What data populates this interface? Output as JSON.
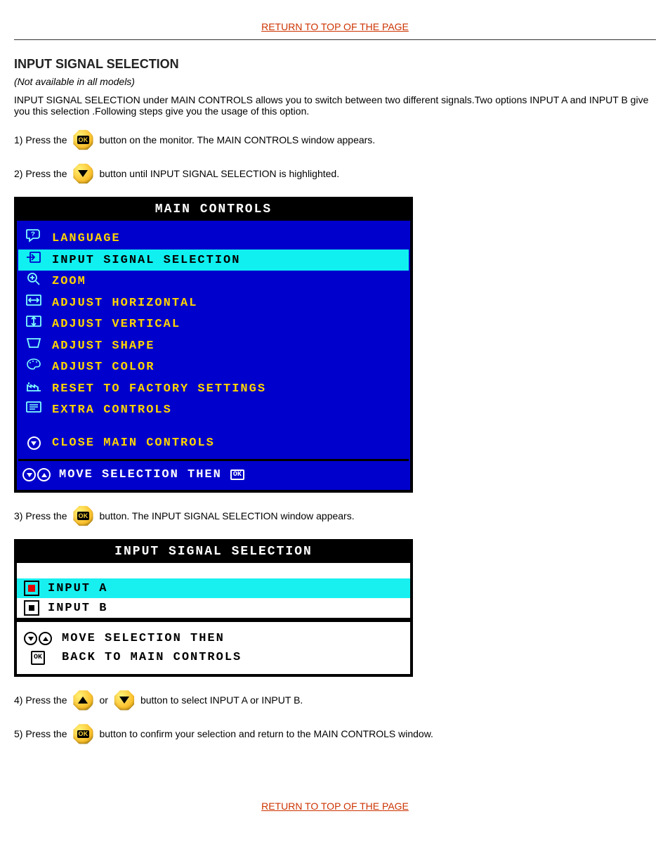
{
  "top_link": "RETURN TO TOP OF THE PAGE",
  "heading": "INPUT SIGNAL SELECTION",
  "note_italic": "(Not available in all models)",
  "intro": "INPUT SIGNAL SELECTION under MAIN CONTROLS allows you to switch between two different signals.Two options INPUT A and INPUT B give you this selection .Following steps give you the usage of this option.",
  "steps": {
    "s1_pre": "1) Press the",
    "s1_post": "button on the monitor. The MAIN CONTROLS window appears.",
    "s2_pre": "2) Press the",
    "s2_post": "button until INPUT SIGNAL SELECTION is highlighted.",
    "s3_pre": "3) Press the",
    "s3_post": "button. The INPUT SIGNAL SELECTION window appears.",
    "s4_pre": "4) Press the",
    "s4_mid": "or",
    "s4_post": "button to select INPUT A or INPUT B.",
    "s5_pre": "5) Press the",
    "s5_post": "button to confirm your selection and return to the MAIN CONTROLS window."
  },
  "osd_main": {
    "title": "MAIN CONTROLS",
    "items": [
      {
        "label": "LANGUAGE",
        "icon": "speech-bubble-q-icon"
      },
      {
        "label": "INPUT SIGNAL SELECTION",
        "icon": "arrow-in-box-icon",
        "selected": true
      },
      {
        "label": "ZOOM",
        "icon": "magnify-plus-icon"
      },
      {
        "label": "ADJUST HORIZONTAL",
        "icon": "arrows-h-box-icon"
      },
      {
        "label": "ADJUST VERTICAL",
        "icon": "arrows-v-box-icon"
      },
      {
        "label": "ADJUST SHAPE",
        "icon": "trapezoid-icon"
      },
      {
        "label": "ADJUST COLOR",
        "icon": "palette-icon"
      },
      {
        "label": "RESET TO FACTORY SETTINGS",
        "icon": "factory-icon"
      },
      {
        "label": "EXTRA CONTROLS",
        "icon": "list-box-icon"
      }
    ],
    "close": "CLOSE MAIN CONTROLS",
    "footer": "MOVE SELECTION THEN",
    "footer_ok": "OK"
  },
  "osd_input": {
    "title": "INPUT SIGNAL SELECTION",
    "options": [
      {
        "label": "INPUT A",
        "selected": true
      },
      {
        "label": "INPUT B",
        "selected": false
      }
    ],
    "foot1": "MOVE SELECTION THEN",
    "foot2": "BACK TO MAIN CONTROLS",
    "foot_ok": "OK"
  },
  "bottom_link": "RETURN TO TOP OF THE PAGE"
}
